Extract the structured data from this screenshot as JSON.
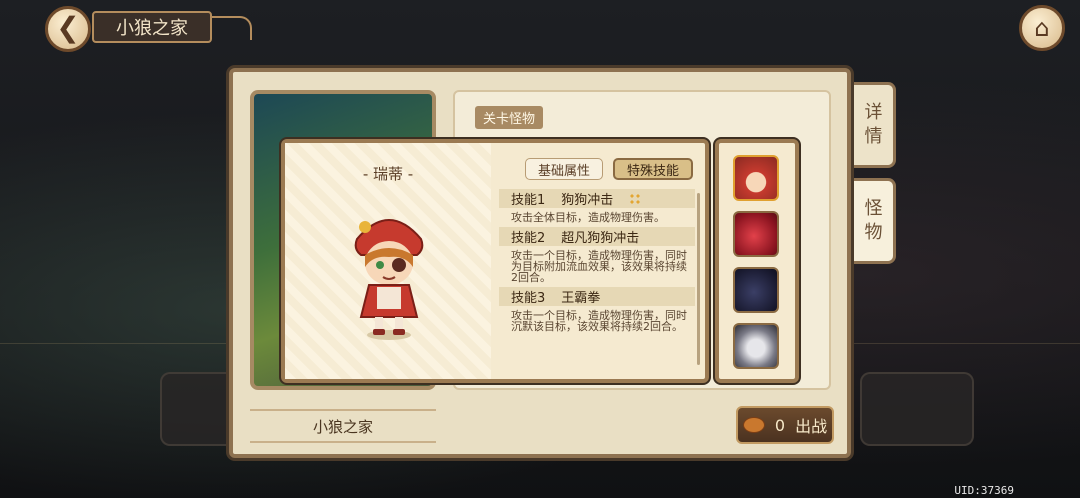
{
  "header": {
    "title": "小狼之家"
  },
  "main": {
    "monster_section_label": "关卡怪物",
    "map_name": "小狼之家",
    "fight_button": {
      "cost": "0",
      "label": "出战"
    }
  },
  "side_tabs": [
    {
      "label_top": "详",
      "label_bottom": "情"
    },
    {
      "label_top": "怪",
      "label_bottom": "物"
    }
  ],
  "popup": {
    "character_name": "- 瑞蒂 -",
    "tabs": {
      "basic": "基础属性",
      "special": "特殊技能"
    },
    "selected_tab": "特殊技能",
    "skills": [
      {
        "index": "技能1",
        "name": "狗狗冲击",
        "desc": "攻击全体目标，造成物理伤害。"
      },
      {
        "index": "技能2",
        "name": "超凡狗狗冲击",
        "desc": "攻击一个目标，造成物理伤害，同时为目标附加流血效果，该效果将持续2回合。"
      },
      {
        "index": "技能3",
        "name": "王霸拳",
        "desc": "攻击一个目标，造成物理伤害，同时沉默该目标，该效果将持续2回合。"
      }
    ]
  },
  "portraits": [
    "red-hood-girl",
    "red-slime",
    "dark-slime",
    "masked-wolf"
  ],
  "uid": "UID:37369",
  "colors": {
    "frame": "#9b7a52",
    "parchment": "#f5ead0",
    "dark_wood": "#4b3220"
  }
}
